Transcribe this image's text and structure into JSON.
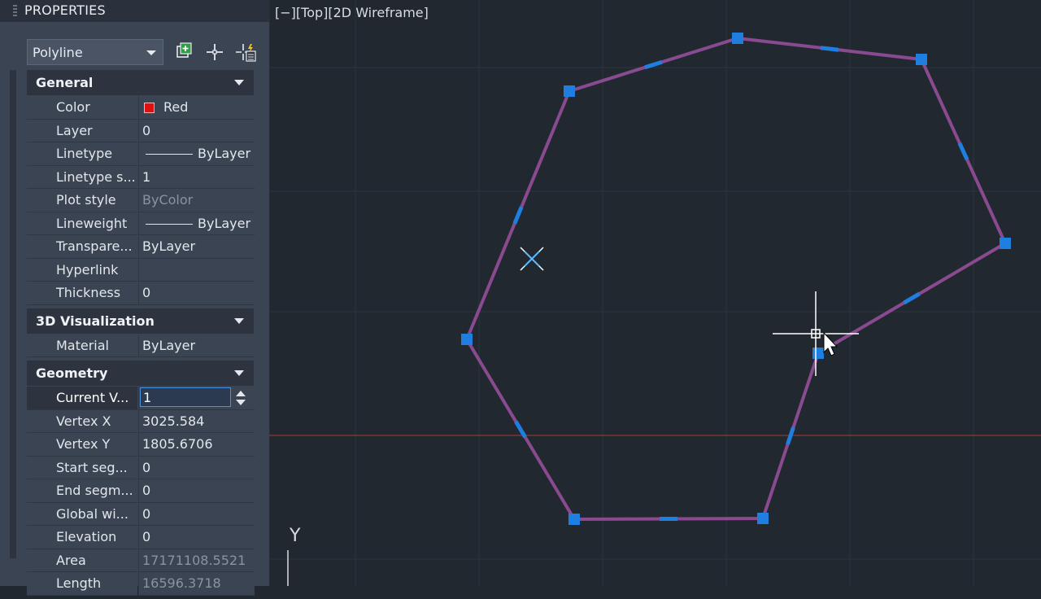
{
  "palette": {
    "title": "PROPERTIES",
    "object_type": "Polyline",
    "tool_icons": [
      "quick-select-icon",
      "select-objects-icon",
      "toggle-pickadd-icon"
    ],
    "sections": [
      {
        "label": "General",
        "rows": [
          {
            "name": "Color",
            "value": "Red",
            "swatch": "#e01010"
          },
          {
            "name": "Layer",
            "value": "0"
          },
          {
            "name": "Linetype",
            "value": "ByLayer",
            "line_sample": true
          },
          {
            "name": "Linetype s...",
            "value": "1"
          },
          {
            "name": "Plot style",
            "value": "ByColor",
            "dim": true
          },
          {
            "name": "Lineweight",
            "value": "ByLayer",
            "line_sample": true
          },
          {
            "name": "Transpare...",
            "value": "ByLayer"
          },
          {
            "name": "Hyperlink",
            "value": ""
          },
          {
            "name": "Thickness",
            "value": "0"
          }
        ]
      },
      {
        "label": "3D Visualization",
        "rows": [
          {
            "name": "Material",
            "value": "ByLayer"
          }
        ]
      },
      {
        "label": "Geometry",
        "rows": [
          {
            "name": "Current V...",
            "value": "1",
            "spinner": true,
            "selected": true
          },
          {
            "name": "Vertex X",
            "value": "3025.584"
          },
          {
            "name": "Vertex Y",
            "value": "1805.6706"
          },
          {
            "name": "Start seg...",
            "value": "0"
          },
          {
            "name": "End segm...",
            "value": "0"
          },
          {
            "name": "Global wi...",
            "value": "0"
          },
          {
            "name": "Elevation",
            "value": "0"
          },
          {
            "name": "Area",
            "value": "17171108.5521",
            "dim": true
          },
          {
            "name": "Length",
            "value": "16596.3718",
            "dim": true
          }
        ]
      }
    ]
  },
  "viewport": {
    "view_label": "[−][Top][2D Wireframe]",
    "ucs_y_label": "Y",
    "background": "#212830",
    "polyline_color": "#8a4a8f",
    "grip_color": "#1e7fe0"
  }
}
